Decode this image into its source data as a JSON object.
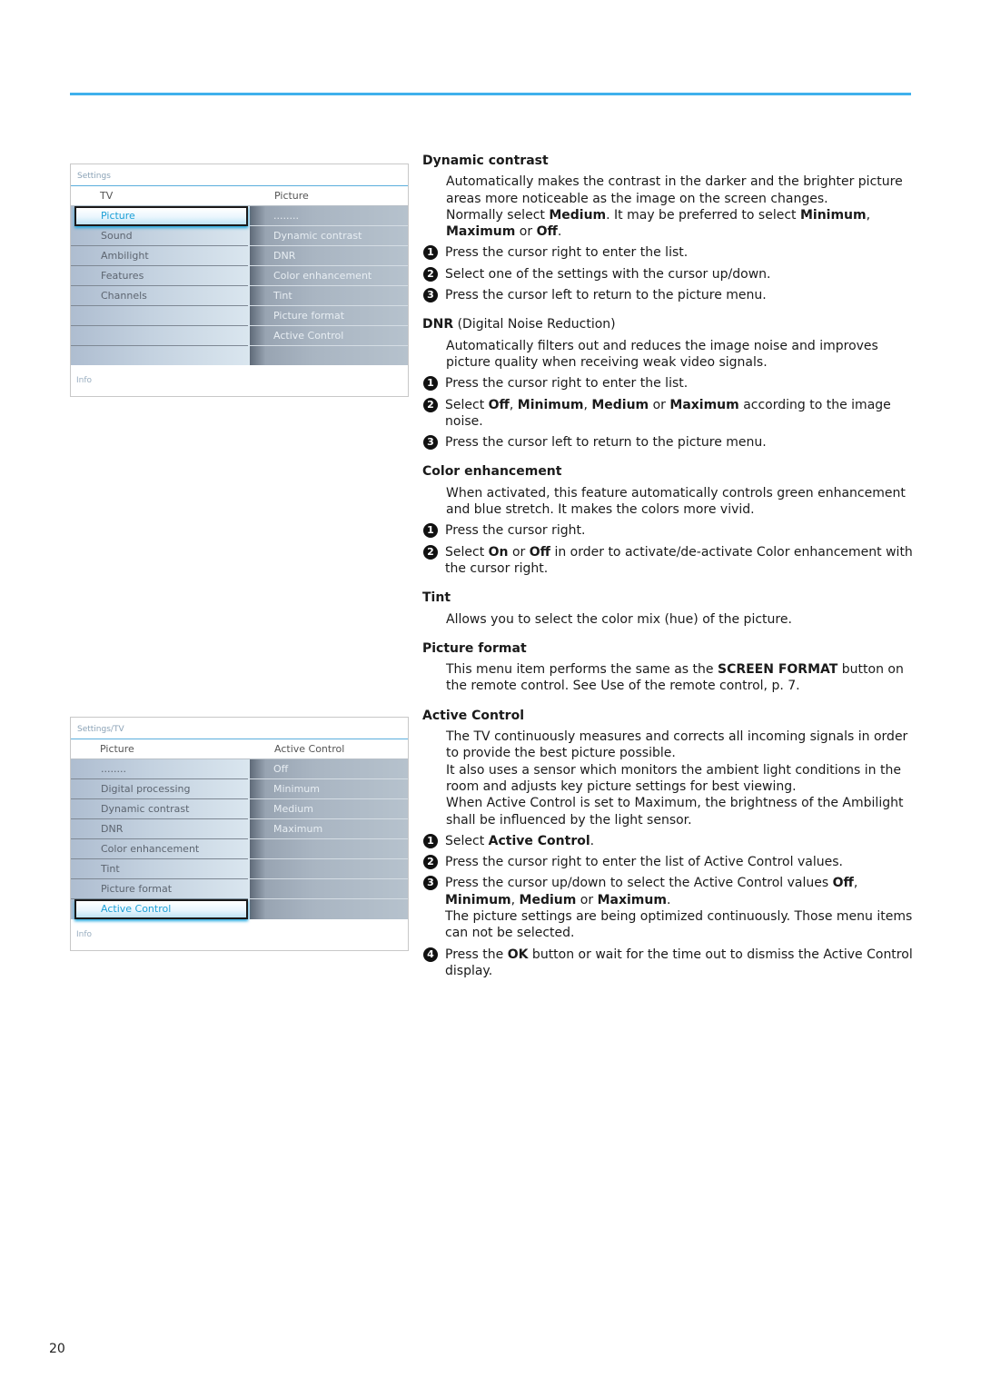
{
  "page": {
    "accent_color": "#3fb0ec",
    "page_number": "20"
  },
  "menu1": {
    "breadcrumb": "Settings",
    "left_header": "TV",
    "right_header": "Picture",
    "left_items": [
      "Picture",
      "Sound",
      "Ambilight",
      "Features",
      "Channels",
      "",
      "",
      ""
    ],
    "selected_left_index": 0,
    "right_items": [
      "........",
      "Dynamic contrast",
      "DNR",
      "Color enhancement",
      "Tint",
      "Picture format",
      "Active Control",
      ""
    ],
    "info": "Info"
  },
  "menu2": {
    "breadcrumb": "Settings/TV",
    "left_header": "Picture",
    "right_header": "Active Control",
    "left_items": [
      "........",
      "Digital processing",
      "Dynamic contrast",
      "DNR",
      "Color enhancement",
      "Tint",
      "Picture format",
      "Active Control"
    ],
    "selected_left_index": 7,
    "right_items": [
      "Off",
      "Minimum",
      "Medium",
      "Maximum",
      "",
      "",
      "",
      ""
    ],
    "info": "Info"
  },
  "sections": {
    "dynamic_contrast": {
      "title": "Dynamic contrast",
      "p1": "Automatically makes the contrast in the darker and the brighter picture areas more noticeable as the image on the screen changes.",
      "p2_a": "Normally select ",
      "p2_b": "Medium",
      "p2_c": ". It may be preferred to select ",
      "p2_d": "Minimum",
      "p2_e": ", ",
      "p2_f": "Maximum",
      "p2_g": " or ",
      "p2_h": "Off",
      "p2_i": ".",
      "steps": [
        "Press the cursor right to enter the list.",
        "Select one of the settings with the cursor up/down.",
        "Press the cursor left to return to the picture menu."
      ]
    },
    "dnr": {
      "title_bold": "DNR",
      "title_rest": " (Digital Noise Reduction)",
      "p1": "Automatically filters out and reduces the image noise and improves picture quality when receiving weak video signals.",
      "step1": "Press the cursor right to enter the list.",
      "step2_a": "Select ",
      "step2_b": "Off",
      "step2_c": ", ",
      "step2_d": "Minimum",
      "step2_e": ", ",
      "step2_f": "Medium",
      "step2_g": " or ",
      "step2_h": "Maximum",
      "step2_i": " according to the image noise.",
      "step3": "Press the cursor left to return to the picture menu."
    },
    "color_enhancement": {
      "title": "Color enhancement",
      "p1": "When activated, this feature automatically controls green enhancement and blue stretch. It makes the colors more vivid.",
      "step1": "Press the cursor right.",
      "step2_a": "Select ",
      "step2_b": "On",
      "step2_c": " or ",
      "step2_d": "Off",
      "step2_e": " in order to activate/de-activate Color enhancement with the cursor right."
    },
    "tint": {
      "title": "Tint",
      "p1": "Allows you to select the color mix (hue) of the picture."
    },
    "picture_format": {
      "title": "Picture format",
      "p1_a": "This menu item performs the same as the ",
      "p1_b": "SCREEN FORMAT",
      "p1_c": " button on the remote control. See Use of the remote control, p. 7."
    },
    "active_control": {
      "title": "Active Control",
      "p1": "The TV continuously measures and corrects all incoming signals in order to provide the best picture possible.",
      "p2": "It also uses a sensor which monitors the ambient light conditions in the room and adjusts key picture settings for best viewing.",
      "p3": "When Active Control is set to Maximum, the brightness of the Ambilight shall be influenced by the light sensor.",
      "step1_a": "Select ",
      "step1_b": "Active Control",
      "step1_c": ".",
      "step2": "Press the cursor right to enter the list of Active Control values.",
      "step3_a": "Press the cursor up/down to select the Active Control values ",
      "step3_b": "Off",
      "step3_c": ", ",
      "step3_d": "Minimum",
      "step3_e": ", ",
      "step3_f": "Medium",
      "step3_g": " or ",
      "step3_h": "Maximum",
      "step3_i": ".",
      "step3_note": "The picture settings are being optimized continuously. Those menu items can not be selected.",
      "step4_a": "Press the ",
      "step4_b": "OK",
      "step4_c": " button or wait for the time out to dismiss the Active Control display."
    }
  },
  "step_numbers": [
    "1",
    "2",
    "3",
    "4"
  ]
}
